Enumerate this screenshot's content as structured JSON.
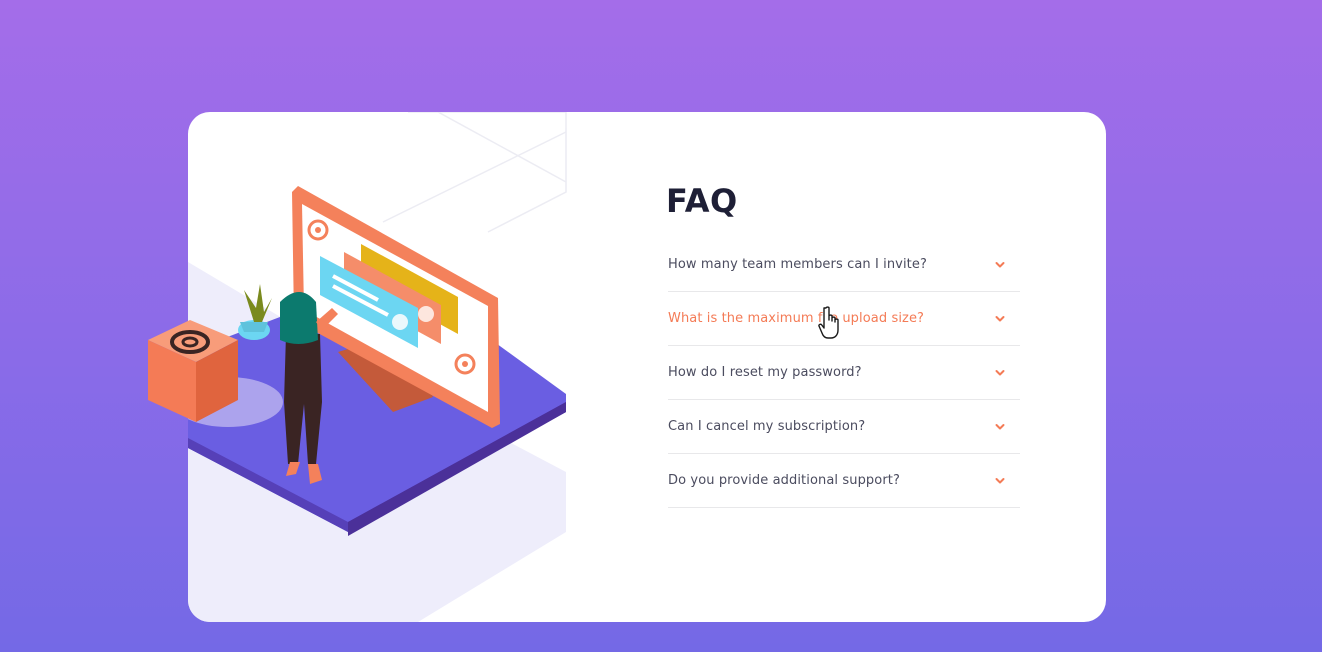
{
  "page": {
    "title": "FAQ"
  },
  "faq": {
    "items": [
      {
        "question": "How many team members can I invite?",
        "active": false
      },
      {
        "question": "What is the maximum file upload size?",
        "active": true
      },
      {
        "question": "How do I reset my password?",
        "active": false
      },
      {
        "question": "Can I cancel my subscription?",
        "active": false
      },
      {
        "question": "Do you provide additional support?",
        "active": false
      }
    ],
    "chevron_icon": "chevron-down-icon"
  },
  "colors": {
    "background_top": "#a46de9",
    "background_bottom": "#7469e6",
    "accent": "#f47b56",
    "title": "#1e1f36",
    "question_text": "#4b4c5f",
    "divider": "#e8e8ea"
  }
}
